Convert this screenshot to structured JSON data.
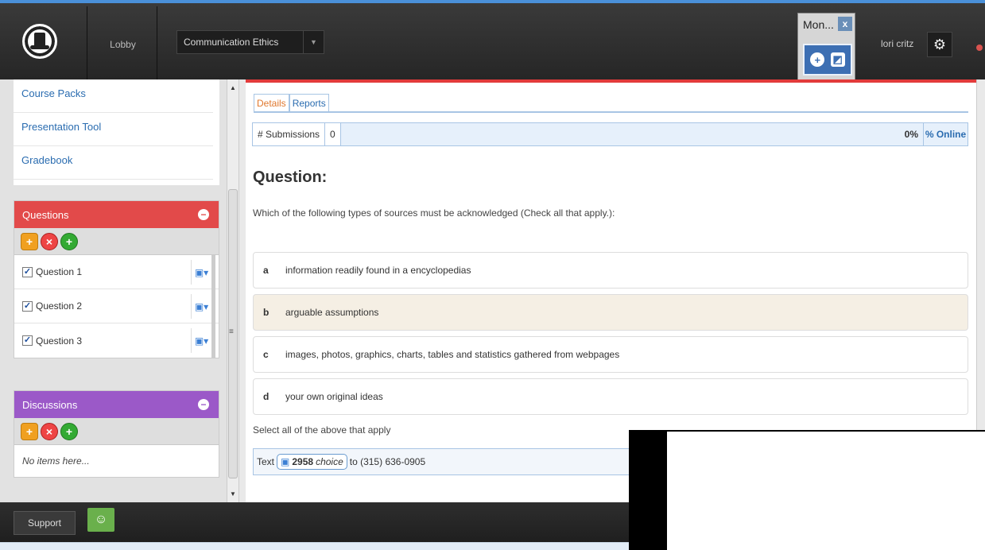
{
  "header": {
    "lobby": "Lobby",
    "course": "Communication Ethics",
    "user": "lori critz",
    "monitor_title": "Mon...",
    "monitor_close": "x"
  },
  "sidebar": {
    "links": [
      "Course Packs",
      "Presentation Tool",
      "Gradebook"
    ],
    "questions": {
      "title": "Questions",
      "color": "#e24a4a",
      "items": [
        "Question 1",
        "Question 2",
        "Question 3"
      ]
    },
    "discussions": {
      "title": "Discussions",
      "color": "#9b59c8",
      "empty": "No items here..."
    }
  },
  "main": {
    "tabs": [
      "Details",
      "Reports"
    ],
    "submissions_label": "# Submissions",
    "submissions_value": "0",
    "percent": "0%",
    "online_label": "% Online",
    "question_heading": "Question:",
    "question_text": "Which of the following types of sources must be acknowledged (Check all that apply.):",
    "choices": [
      {
        "letter": "a",
        "text": "information readily found in a encyclopedias"
      },
      {
        "letter": "b",
        "text": "arguable assumptions"
      },
      {
        "letter": "c",
        "text": "images, photos, graphics, charts, tables and statistics gathered from webpages"
      },
      {
        "letter": "d",
        "text": "your own original ideas"
      }
    ],
    "hint": "Select all of the above that apply",
    "text_prefix": "Text",
    "text_code": "2958",
    "text_choice": "choice",
    "text_suffix": "to (315) 636-0905"
  },
  "footer": {
    "support": "Support"
  }
}
